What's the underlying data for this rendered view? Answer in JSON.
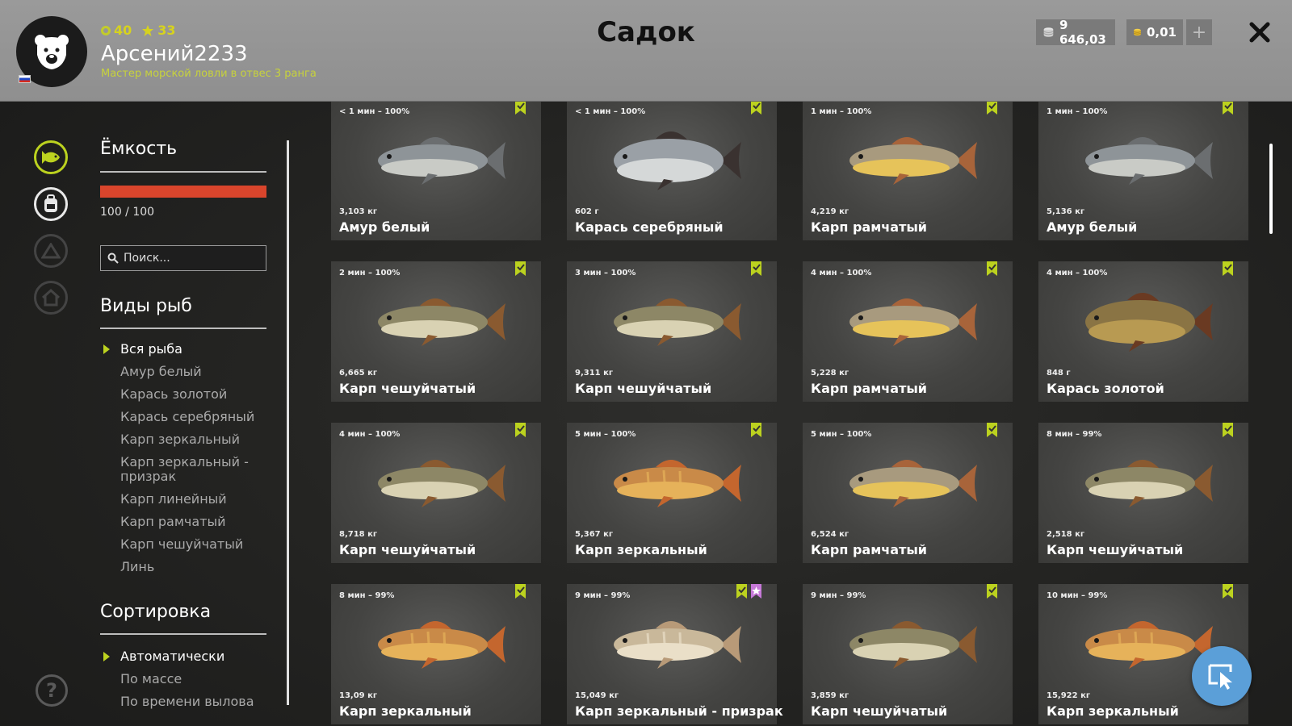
{
  "header": {
    "title": "Садок",
    "level": "40",
    "stars": "33",
    "username": "Арсений2233",
    "rank": "Мастер морской ловли в отвес 3 ранга",
    "silver": "9 646,03",
    "gold": "0,01",
    "add_label": "+"
  },
  "sidebar": {
    "capacity_title": "Ёмкость",
    "capacity_text": "100 / 100",
    "capacity_fraction": 1.0,
    "search_placeholder": "Поиск...",
    "species_title": "Виды рыб",
    "species": [
      "Вся рыба",
      "Амур белый",
      "Карась золотой",
      "Карась серебряный",
      "Карп зеркальный",
      "Карп зеркальный - призрак",
      "Карп линейный",
      "Карп рамчатый",
      "Карп чешуйчатый",
      "Линь"
    ],
    "sort_title": "Сортировка",
    "sort_options": [
      "Автоматически",
      "По массе",
      "По времени вылова"
    ]
  },
  "colors": {
    "accent": "#bcd21f",
    "capacity_bar": "#d9452c",
    "trophy_mark": "#c678d8",
    "fab": "#5b9fd8"
  },
  "fish": [
    {
      "time": "< 1 мин – 100%",
      "weight": "3,103 кг",
      "name": "Амур белый",
      "kind": "amur",
      "trophy": false
    },
    {
      "time": "< 1 мин – 100%",
      "weight": "602 г",
      "name": "Карась серебряный",
      "kind": "silver",
      "trophy": false
    },
    {
      "time": "1 мин – 100%",
      "weight": "4,219 кг",
      "name": "Карп рамчатый",
      "kind": "framed",
      "trophy": false
    },
    {
      "time": "1 мин – 100%",
      "weight": "5,136 кг",
      "name": "Амур белый",
      "kind": "amur",
      "trophy": false
    },
    {
      "time": "2 мин – 100%",
      "weight": "6,665 кг",
      "name": "Карп чешуйчатый",
      "kind": "scaled",
      "trophy": false
    },
    {
      "time": "3 мин – 100%",
      "weight": "9,311 кг",
      "name": "Карп чешуйчатый",
      "kind": "scaled",
      "trophy": false
    },
    {
      "time": "4 мин – 100%",
      "weight": "5,228 кг",
      "name": "Карп рамчатый",
      "kind": "framed",
      "trophy": false
    },
    {
      "time": "4 мин – 100%",
      "weight": "848 г",
      "name": "Карась золотой",
      "kind": "golden",
      "trophy": false
    },
    {
      "time": "4 мин – 100%",
      "weight": "8,718 кг",
      "name": "Карп чешуйчатый",
      "kind": "scaled",
      "trophy": false
    },
    {
      "time": "5 мин – 100%",
      "weight": "5,367 кг",
      "name": "Карп зеркальный",
      "kind": "mirror",
      "trophy": false
    },
    {
      "time": "5 мин – 100%",
      "weight": "6,524 кг",
      "name": "Карп рамчатый",
      "kind": "framed",
      "trophy": false
    },
    {
      "time": "8 мин – 99%",
      "weight": "2,518 кг",
      "name": "Карп чешуйчатый",
      "kind": "scaled",
      "trophy": false
    },
    {
      "time": "8 мин – 99%",
      "weight": "13,09 кг",
      "name": "Карп зеркальный",
      "kind": "mirror",
      "trophy": false
    },
    {
      "time": "9 мин – 99%",
      "weight": "15,049 кг",
      "name": "Карп зеркальный - призрак",
      "kind": "ghost",
      "trophy": true
    },
    {
      "time": "9 мин – 99%",
      "weight": "3,859 кг",
      "name": "Карп чешуйчатый",
      "kind": "scaled",
      "trophy": false
    },
    {
      "time": "10 мин – 99%",
      "weight": "15,922 кг",
      "name": "Карп зеркальный",
      "kind": "mirror",
      "trophy": false
    }
  ]
}
